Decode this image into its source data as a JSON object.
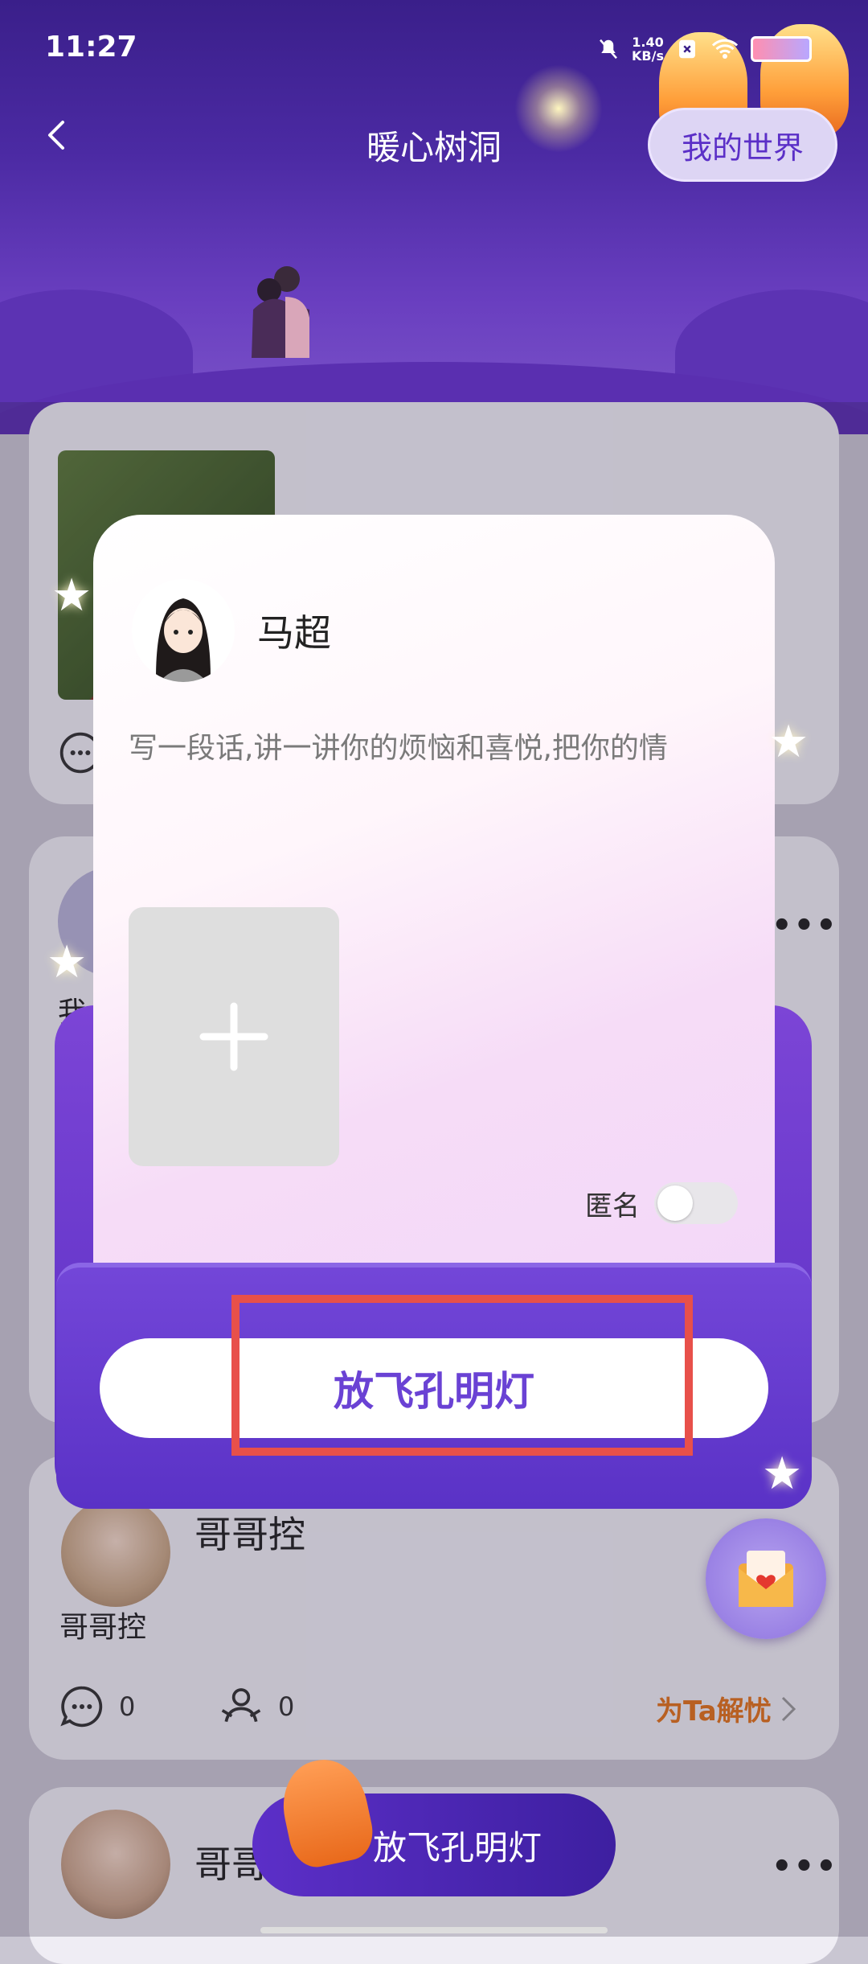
{
  "status_bar": {
    "time": "11:27",
    "network_speed": "1.40",
    "network_unit": "KB/s"
  },
  "header": {
    "title": "暖心树洞",
    "my_world_label": "我的世界"
  },
  "feed": {
    "posts": [
      {
        "name": "哥哥控",
        "text": "哥哥控",
        "comments": "0",
        "hugs": "0",
        "help_label": "为Ta解忧"
      },
      {
        "name": "哥哥"
      }
    ],
    "partial_label": "我"
  },
  "modal": {
    "user_name": "马超",
    "placeholder": "写一段话,讲一讲你的烦恼和喜悦,把你的情",
    "anonymous_label": "匿名",
    "anonymous_on": false,
    "launch_label": "放飞孔明灯"
  },
  "bottom": {
    "launch_label": "放飞孔明灯"
  },
  "colors": {
    "accent": "#6a42d4",
    "highlight": "#e8504a",
    "help": "#e0731c"
  }
}
